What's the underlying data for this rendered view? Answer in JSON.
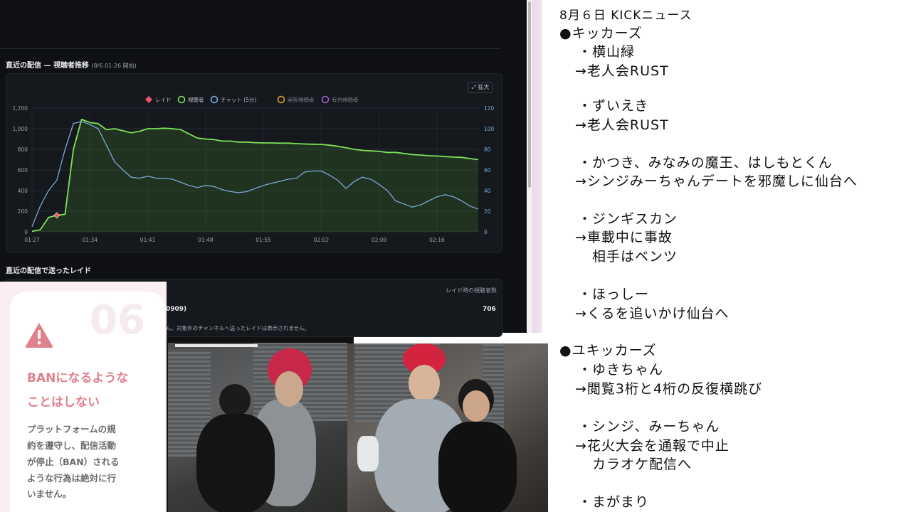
{
  "dashboard": {
    "chart_title": "直近の配信 — 視聴者推移",
    "chart_subtitle": "(8/6 01:26 開始)",
    "expand_label": "⤢ 拡大",
    "legend": [
      {
        "label": "レイド",
        "marker": "diamond",
        "color": "#e8566b",
        "disabled": false
      },
      {
        "label": "視聴者",
        "marker": "circle",
        "color": "#7ee25a",
        "disabled": false
      },
      {
        "label": "チャット (5分)",
        "marker": "circle",
        "color": "#7aa8d8",
        "disabled": false
      },
      {
        "label": "実質視聴者",
        "marker": "circle",
        "color": "#d9a21c",
        "disabled": true
      },
      {
        "label": "有力視聴者",
        "marker": "circle",
        "color": "#a45ed6",
        "disabled": true
      }
    ],
    "raids_title": "直近の配信で送ったレイド",
    "raids_header": "レイド時の視聴者数",
    "raid_row_name": "0909)",
    "raid_row_value": "706",
    "raids_note": "ん。対象外のチャンネルへ送ったレイドは表示されません。"
  },
  "chart_data": {
    "type": "line",
    "x": [
      "01:27",
      "01:28",
      "01:29",
      "01:30",
      "01:31",
      "01:32",
      "01:33",
      "01:34",
      "01:35",
      "01:36",
      "01:37",
      "01:38",
      "01:39",
      "01:40",
      "01:41",
      "01:42",
      "01:43",
      "01:44",
      "01:45",
      "01:46",
      "01:47",
      "01:48",
      "01:49",
      "01:50",
      "01:51",
      "01:52",
      "01:53",
      "01:54",
      "01:55",
      "01:56",
      "01:57",
      "01:58",
      "01:59",
      "02:00",
      "02:01",
      "02:02",
      "02:03",
      "02:04",
      "02:05",
      "02:06",
      "02:07",
      "02:08",
      "02:09",
      "02:10",
      "02:11",
      "02:12",
      "02:13",
      "02:14",
      "02:15",
      "02:16",
      "02:17",
      "02:18",
      "02:19",
      "02:20",
      "02:21"
    ],
    "x_ticks": [
      "01:27",
      "01:34",
      "01:41",
      "01:48",
      "01:55",
      "02:02",
      "02:09",
      "02:16"
    ],
    "y_left_ticks": [
      "0",
      "200",
      "400",
      "600",
      "800",
      "1,000",
      "1,200"
    ],
    "y_right_ticks": [
      "0",
      "20",
      "40",
      "60",
      "80",
      "100",
      "120"
    ],
    "ylim_left": [
      0,
      1200
    ],
    "ylim_right": [
      0,
      120
    ],
    "series": [
      {
        "name": "視聴者",
        "axis": "left",
        "color": "#7ee25a",
        "values": [
          5,
          20,
          140,
          160,
          170,
          800,
          1090,
          1060,
          1050,
          990,
          1000,
          980,
          960,
          975,
          1000,
          1000,
          1005,
          1000,
          990,
          950,
          910,
          900,
          895,
          880,
          880,
          870,
          870,
          865,
          862,
          862,
          860,
          860,
          855,
          852,
          850,
          848,
          840,
          830,
          815,
          800,
          790,
          785,
          780,
          770,
          770,
          760,
          750,
          745,
          738,
          735,
          730,
          725,
          722,
          710,
          700
        ]
      },
      {
        "name": "チャット (5分)",
        "axis": "right",
        "color": "#7aa8d8",
        "values": [
          5,
          25,
          40,
          50,
          80,
          105,
          107,
          104,
          100,
          84,
          68,
          60,
          53,
          52,
          54,
          52,
          52,
          51,
          48,
          45,
          43,
          45,
          44,
          41,
          39,
          38,
          39,
          42,
          45,
          47,
          49,
          51,
          52,
          58,
          59,
          59,
          55,
          50,
          42,
          49,
          53,
          51,
          46,
          40,
          30,
          27,
          24,
          26,
          30,
          34,
          36,
          34,
          30,
          25,
          22
        ]
      },
      {
        "name": "レイド",
        "axis": "left",
        "color": "#e8566b",
        "points": [
          {
            "x": "01:30",
            "y": 160
          }
        ]
      }
    ]
  },
  "rule_card": {
    "number": "06",
    "heading_line1": "BANになるような",
    "heading_line2": "ことはしない",
    "body_lines": [
      "プラットフォームの規",
      "約を遵守し、配信活動",
      "が停止（BAN）される",
      "ような行為は絶対に行",
      "いません。"
    ]
  },
  "notes": {
    "lines": [
      "8月６日 KICKニュース",
      "●キッカーズ",
      "・横山緑",
      "→老人会RUST",
      "・ずいえき",
      "→老人会RUST",
      "・かつき、みなみの魔王、はしもとくん",
      "→シンジみーちゃんデートを邪魔しに仙台へ",
      "・ジンギスカン",
      "→車載中に事故",
      "相手はベンツ",
      "・ほっしー",
      "→くるを追いかけ仙台へ",
      "●ユキッカーズ",
      "・ゆきちゃん",
      "→閲覧3桁と4桁の反復横跳び",
      "・シンジ、みーちゃん",
      "→花火大会を通報で中止",
      "カラオケ配信へ",
      "・まがまり"
    ]
  }
}
